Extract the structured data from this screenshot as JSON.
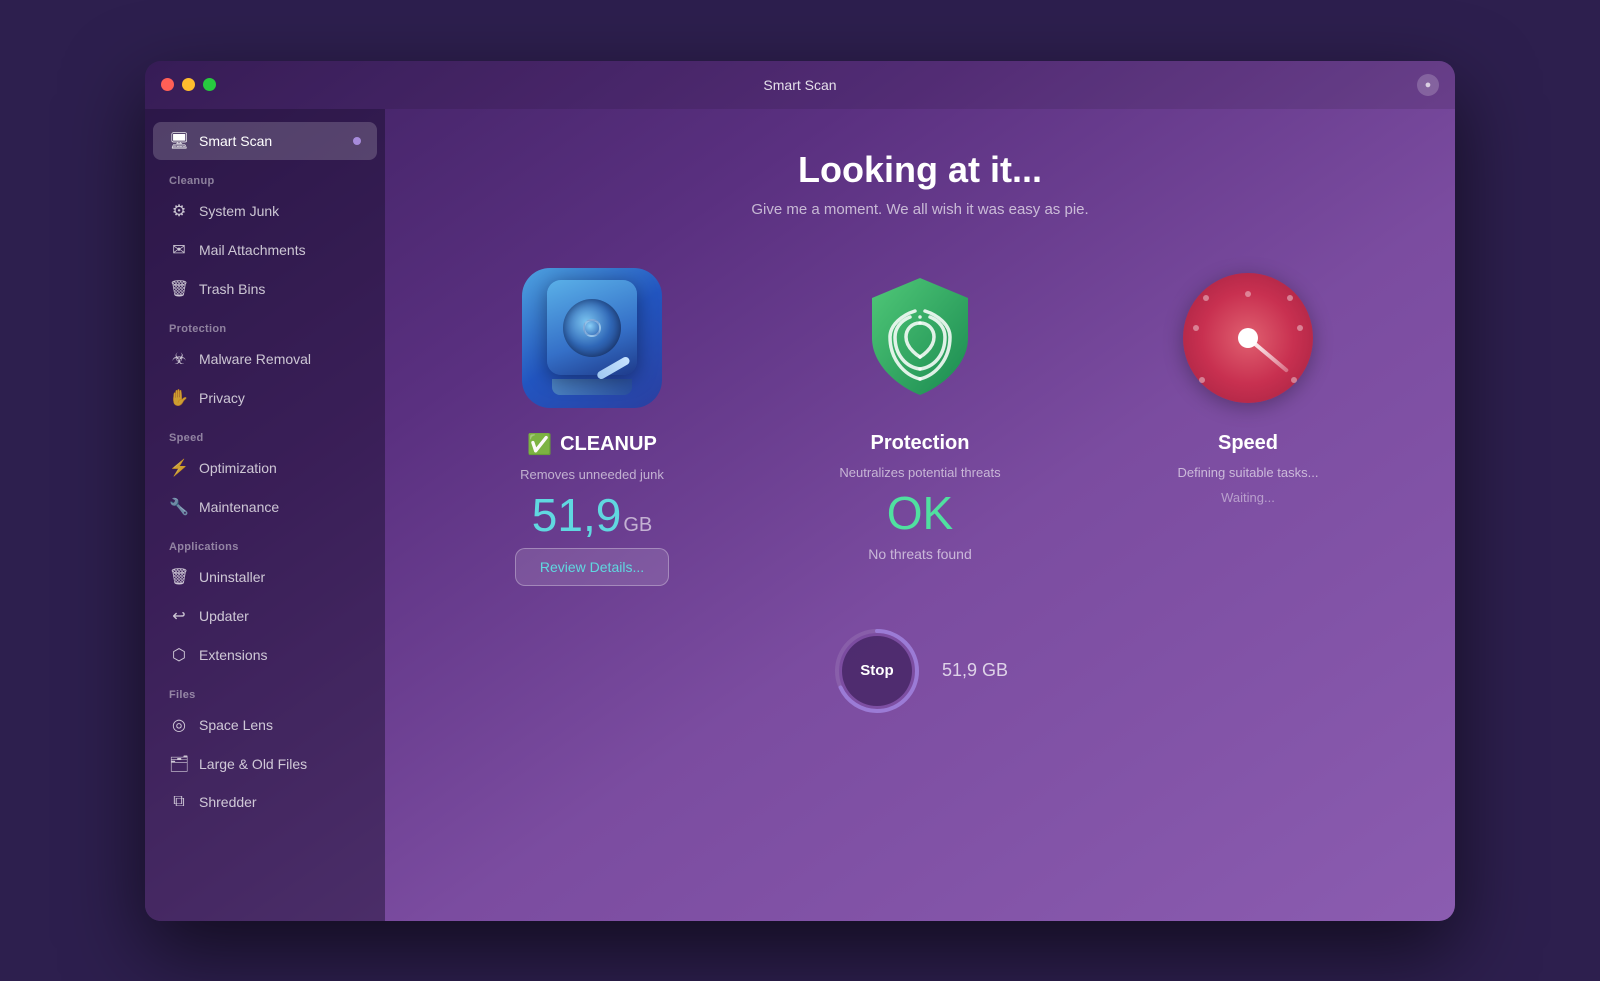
{
  "window": {
    "title": "Smart Scan",
    "settings_label": "⚙"
  },
  "sidebar": {
    "smart_scan_label": "Smart Scan",
    "sections": [
      {
        "key": "cleanup",
        "label": "Cleanup",
        "items": [
          {
            "key": "system-junk",
            "label": "System Junk",
            "icon": "⚙"
          },
          {
            "key": "mail-attachments",
            "label": "Mail Attachments",
            "icon": "✉"
          },
          {
            "key": "trash-bins",
            "label": "Trash Bins",
            "icon": "🗑"
          }
        ]
      },
      {
        "key": "protection",
        "label": "Protection",
        "items": [
          {
            "key": "malware-removal",
            "label": "Malware Removal",
            "icon": "☣"
          },
          {
            "key": "privacy",
            "label": "Privacy",
            "icon": "🤚"
          }
        ]
      },
      {
        "key": "speed",
        "label": "Speed",
        "items": [
          {
            "key": "optimization",
            "label": "Optimization",
            "icon": "⚡"
          },
          {
            "key": "maintenance",
            "label": "Maintenance",
            "icon": "🔧"
          }
        ]
      },
      {
        "key": "applications",
        "label": "Applications",
        "items": [
          {
            "key": "uninstaller",
            "label": "Uninstaller",
            "icon": "🗑"
          },
          {
            "key": "updater",
            "label": "Updater",
            "icon": "↩"
          },
          {
            "key": "extensions",
            "label": "Extensions",
            "icon": "⬡"
          }
        ]
      },
      {
        "key": "files",
        "label": "Files",
        "items": [
          {
            "key": "space-lens",
            "label": "Space Lens",
            "icon": "◎"
          },
          {
            "key": "large-old-files",
            "label": "Large & Old Files",
            "icon": "🗂"
          },
          {
            "key": "shredder",
            "label": "Shredder",
            "icon": "⧉"
          }
        ]
      }
    ]
  },
  "main": {
    "title": "Looking at it...",
    "subtitle": "Give me a moment. We all wish it was easy as pie.",
    "cards": [
      {
        "key": "cleanup",
        "title": "CLEANUP",
        "has_check": true,
        "desc": "Removes unneeded junk",
        "value": "51,9",
        "unit": "GB",
        "action_label": "Review Details..."
      },
      {
        "key": "protection",
        "title": "Protection",
        "has_check": false,
        "desc": "Neutralizes potential threats",
        "status": "OK",
        "status_sub": "No threats found"
      },
      {
        "key": "speed",
        "title": "Speed",
        "has_check": false,
        "desc": "Defining suitable tasks...",
        "waiting": "Waiting..."
      }
    ],
    "stop_label": "Stop",
    "stop_size_label": "51,9 GB"
  }
}
